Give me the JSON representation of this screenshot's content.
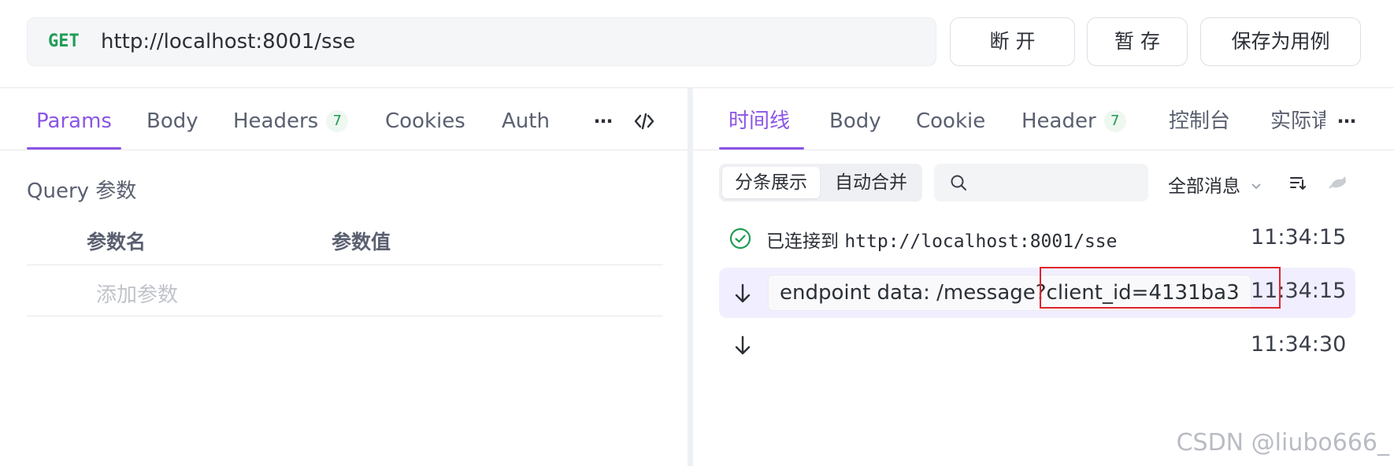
{
  "request": {
    "method": "GET",
    "url": "http://localhost:8001/sse"
  },
  "actions": {
    "disconnect": "断 开",
    "stash": "暂 存",
    "save_case": "保存为用例"
  },
  "left_tabs": [
    {
      "label": "Params",
      "active": true
    },
    {
      "label": "Body"
    },
    {
      "label": "Headers",
      "badge": "7"
    },
    {
      "label": "Cookies"
    },
    {
      "label": "Auth"
    }
  ],
  "left_icons": [
    "more-icon",
    "code-icon"
  ],
  "query": {
    "title": "Query 参数",
    "col_name": "参数名",
    "col_value": "参数值",
    "add_placeholder": "添加参数"
  },
  "right_tabs": [
    {
      "label": "时间线",
      "active": true
    },
    {
      "label": "Body"
    },
    {
      "label": "Cookie"
    },
    {
      "label": "Header",
      "badge": "7"
    },
    {
      "label": "控制台"
    },
    {
      "label": "实际请"
    }
  ],
  "timeline": {
    "mode_split": "分条展示",
    "mode_merge": "自动合并",
    "filter": "全部消息",
    "events": [
      {
        "icon": "check-circle-icon",
        "text": "已连接到 ",
        "mono": "http://localhost:8001/sse",
        "time": "11:34:15"
      },
      {
        "icon": "arrow-down-icon",
        "text": "endpoint data: /message?client_id=4131ba3",
        "time": "11:34:15"
      },
      {
        "icon": "arrow-down-icon",
        "text": "",
        "time": "11:34:30"
      }
    ]
  },
  "watermark": "CSDN @liubo666_",
  "colors": {
    "accent": "#8b55e6",
    "method": "#1f9d55",
    "highlight": "#e0242e"
  }
}
